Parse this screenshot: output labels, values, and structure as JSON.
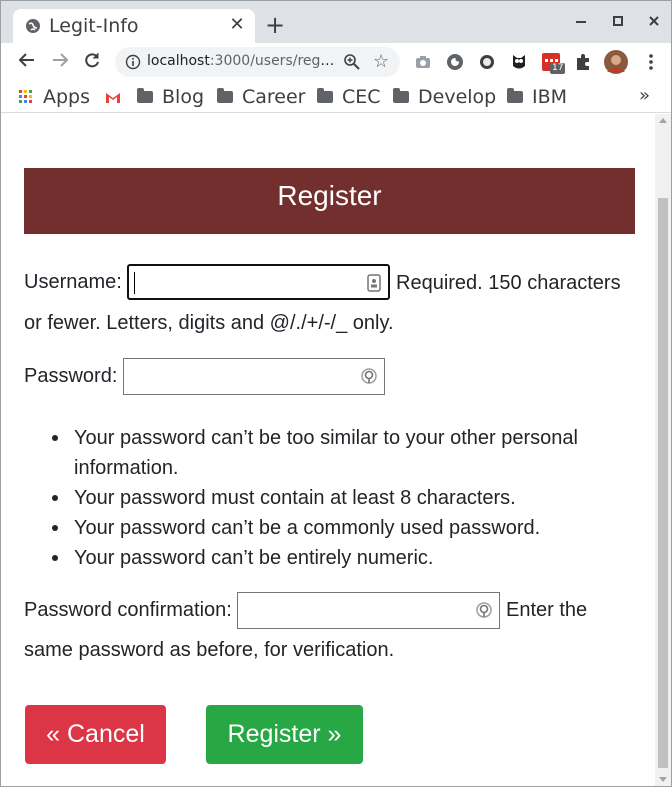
{
  "browser": {
    "tab_title": "Legit-Info",
    "tab_close": "✕",
    "new_tab": "+",
    "url_host": "localhost",
    "url_path": ":3000/users/regi...",
    "extension_badge": "17",
    "bookmarks": [
      {
        "label": "Apps",
        "kind": "apps"
      },
      {
        "label": "",
        "kind": "gmail"
      },
      {
        "label": "Blog",
        "kind": "folder"
      },
      {
        "label": "Career",
        "kind": "folder"
      },
      {
        "label": "CEC",
        "kind": "folder"
      },
      {
        "label": "Develop",
        "kind": "folder"
      },
      {
        "label": "IBM",
        "kind": "folder"
      }
    ],
    "bookmarks_more": "»"
  },
  "page": {
    "heading": "Register",
    "username": {
      "label": "Username:",
      "value": "",
      "help_part1": "Required. 150 characters",
      "help_part2": "or fewer. Letters, digits and @/./+/-/_ only."
    },
    "password": {
      "label": "Password:",
      "value": ""
    },
    "password_rules": [
      "Your password can’t be too similar to your other personal information.",
      "Your password must contain at least 8 characters.",
      "Your password can’t be a commonly used password.",
      "Your password can’t be entirely numeric."
    ],
    "password_confirm": {
      "label": "Password confirmation:",
      "value": "",
      "help_part1": "Enter the",
      "help_part2": "same password as before, for verification."
    },
    "buttons": {
      "cancel": "« Cancel",
      "register": "Register »"
    }
  },
  "colors": {
    "banner": "#722f2d",
    "cancel": "#dc3545",
    "register": "#28a745"
  }
}
